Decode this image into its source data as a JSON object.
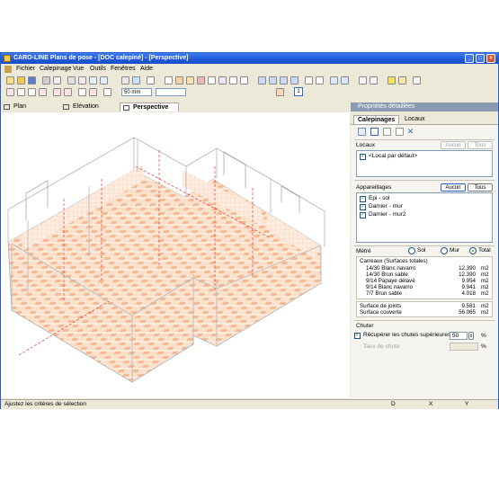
{
  "window": {
    "title": "CARO-LINE Plans de pose - [DOC calepiné] - [Perspective]",
    "buttons": {
      "minimize": "_",
      "maximize": "□",
      "close": "×"
    }
  },
  "menu": [
    "Fichier",
    "Calepinage",
    "Vue",
    "Outils",
    "Fenêtres",
    "Aide"
  ],
  "toolbar": {
    "zoom": "50 mm",
    "page": "1"
  },
  "view_tabs": [
    {
      "label": "Plan"
    },
    {
      "label": "Elévation"
    },
    {
      "label": "Perspective",
      "active": true
    }
  ],
  "panel": {
    "header": "Propriétés détaillées",
    "tabs": [
      "Calepinages",
      "Locaux"
    ],
    "locaux": {
      "title": "Locaux",
      "btn_none": "Aucun",
      "btn_all": "Tous",
      "items": [
        {
          "label": "<Local par défaut>",
          "checked": true
        }
      ]
    },
    "appareillages": {
      "title": "Appareillages",
      "btn_none": "Aucun",
      "btn_all": "Tous",
      "items": [
        {
          "label": "Epi - sol",
          "checked": true
        },
        {
          "label": "Damier - mur",
          "checked": true
        },
        {
          "label": "Damier - mur2",
          "checked": true
        }
      ]
    },
    "metre": {
      "title": "Métré",
      "options": [
        "Sol",
        "Mur",
        "Total"
      ],
      "selected": "Total",
      "header": "Carreaux (Surfaces totales)",
      "rows": [
        {
          "name": "14/30 Blanc navarro",
          "value": "12.390",
          "unit": "m2"
        },
        {
          "name": "14/30 Brun sable",
          "value": "12.390",
          "unit": "m2"
        },
        {
          "name": "9/14 Papaye délavé",
          "value": "9.954",
          "unit": "m2"
        },
        {
          "name": "9/14 Blanc navarro",
          "value": "9.941",
          "unit": "m2"
        },
        {
          "name": "7/7 Brun sable",
          "value": "4.018",
          "unit": "m2"
        }
      ],
      "totals": [
        {
          "name": "Surface de joints",
          "value": "9.581",
          "unit": "m2"
        },
        {
          "name": "Surface couverte",
          "value": "56.065",
          "unit": "m2"
        }
      ]
    },
    "chutes": {
      "title": "Chuter",
      "recover_label": "Récupérer les chutes supérieures à",
      "recover_value": "50",
      "recover_unit": "%",
      "rate_label": "Taux de chute",
      "rate_unit": "%"
    }
  },
  "statusbar": {
    "message": "Ajustez les critères de sélection",
    "col_d": "D",
    "col_x": "X",
    "col_y": "Y"
  }
}
